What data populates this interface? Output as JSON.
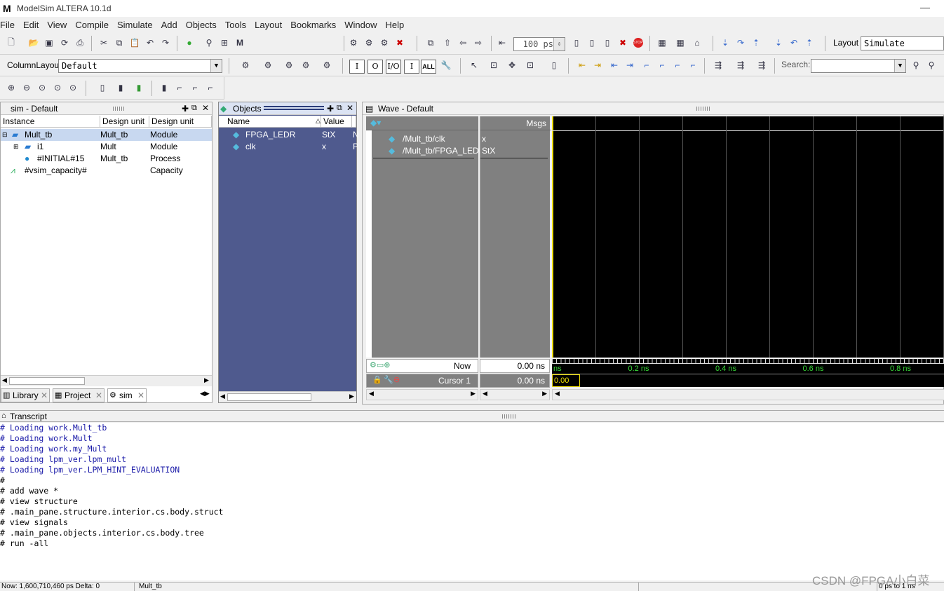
{
  "app": {
    "title": "ModelSim ALTERA 10.1d",
    "logo_letter": "M",
    "minimize_glyph": "—"
  },
  "menu": [
    "File",
    "Edit",
    "View",
    "Compile",
    "Simulate",
    "Add",
    "Objects",
    "Tools",
    "Layout",
    "Bookmarks",
    "Window",
    "Help"
  ],
  "toolbar": {
    "run_length": "100 ps",
    "layout_label": "Layout",
    "layout_value": "Simulate",
    "column_layout_label": "ColumnLayout",
    "column_layout_value": "Default",
    "search_label": "Search:",
    "search_value": "",
    "io_buttons": [
      "I",
      "O",
      "I/O",
      "I",
      "ALL"
    ]
  },
  "sim_panel": {
    "title": "sim - Default",
    "columns": [
      "Instance",
      "Design unit",
      "Design unit type"
    ],
    "rows": [
      {
        "instance": "Mult_tb",
        "unit": "Mult_tb",
        "type": "Module",
        "selected": true
      },
      {
        "instance": "i1",
        "unit": "Mult",
        "type": "Module"
      },
      {
        "instance": "#INITIAL#15",
        "unit": "Mult_tb",
        "type": "Process"
      },
      {
        "instance": "#vsim_capacity#",
        "unit": "",
        "type": "Capacity"
      }
    ],
    "tabs": [
      "Library",
      "Project",
      "sim"
    ]
  },
  "objects_panel": {
    "title": "Objects",
    "columns": [
      "Name",
      "Value",
      "K"
    ],
    "rows": [
      {
        "name": "FPGA_LEDR",
        "value": "StX",
        "kind": "N"
      },
      {
        "name": "clk",
        "value": "x",
        "kind": "P"
      }
    ]
  },
  "wave_panel": {
    "title": "Wave - Default",
    "msgs_label": "Msgs",
    "signals": [
      {
        "name": "/Mult_tb/clk",
        "value": "x"
      },
      {
        "name": "/Mult_tb/FPGA_LEDR",
        "value": "StX"
      }
    ],
    "now_label": "Now",
    "now_value": "0.00 ns",
    "cursor_label": "Cursor 1",
    "cursor_value": "0.00 ns",
    "cursor_tag": "0.00 ns",
    "time_ticks": [
      "ns",
      "0.2 ns",
      "0.4 ns",
      "0.6 ns",
      "0.8 ns"
    ]
  },
  "transcript": {
    "title": "Transcript",
    "lines": [
      {
        "text": "# Loading work.Mult_tb",
        "blue": true
      },
      {
        "text": "# Loading work.Mult",
        "blue": true
      },
      {
        "text": "# Loading work.my_Mult",
        "blue": true
      },
      {
        "text": "# Loading lpm_ver.lpm_mult",
        "blue": true
      },
      {
        "text": "# Loading lpm_ver.LPM_HINT_EVALUATION",
        "blue": true
      },
      {
        "text": "#",
        "blue": false
      },
      {
        "text": "# add wave *",
        "blue": false
      },
      {
        "text": "# view structure",
        "blue": false
      },
      {
        "text": "# .main_pane.structure.interior.cs.body.struct",
        "blue": false
      },
      {
        "text": "# view signals",
        "blue": false
      },
      {
        "text": "# .main_pane.objects.interior.cs.body.tree",
        "blue": false
      },
      {
        "text": "# run -all",
        "blue": false
      }
    ]
  },
  "status": {
    "left": "Now: 1,600,710,460 ps  Delta: 0",
    "mid": "Mult_tb",
    "right": "0 ps to 1 ns"
  },
  "watermark": "CSDN @FPGA小白菜",
  "colors": {
    "objects_bg": "#4f5a8e",
    "wave_bg": "#000000",
    "signal_pane_bg": "#808080",
    "tick_green": "#38d838",
    "cursor_yellow": "#f0e000",
    "selection": "#c8d8f0"
  }
}
